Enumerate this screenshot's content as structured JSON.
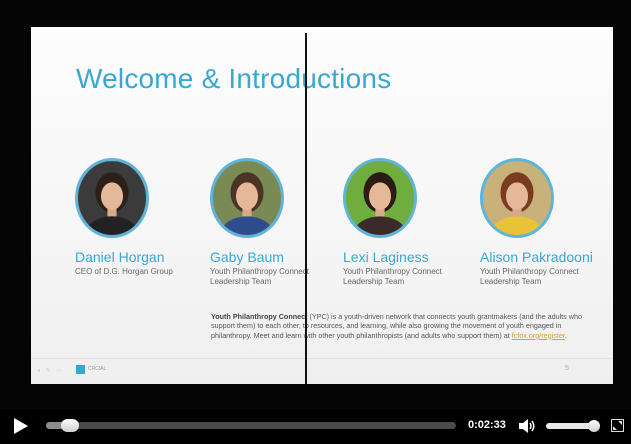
{
  "slide": {
    "title": "Welcome & Introductions",
    "page_number": "5",
    "logo_text": "CRCIAL"
  },
  "people": [
    {
      "name": "Daniel Horgan",
      "role": "CEO of D.G. Horgan Group",
      "photo_bg": "#3b3b3b",
      "hair": "#2b2118",
      "shirt": "#222222"
    },
    {
      "name": "Gaby Baum",
      "role": "Youth Philanthropy Connect Leadership Team",
      "photo_bg": "#7a8a55",
      "hair": "#4a3424",
      "shirt": "#2f4d8c"
    },
    {
      "name": "Lexi Laginess",
      "role": "Youth Philanthropy Connect Leadership Team",
      "photo_bg": "#6fae3e",
      "hair": "#2a1c14",
      "shirt": "#3b2a2a"
    },
    {
      "name": "Alison Pakradooni",
      "role": "Youth Philanthropy Connect Leadership Team",
      "photo_bg": "#c9b27a",
      "hair": "#7a3b1f",
      "shirt": "#e8c33a"
    }
  ],
  "description": {
    "org_name": "Youth Philanthropy Connect",
    "body": " (YPC) is a youth-driven network that connects youth grantmakers (and the adults who support them) to each other, to resources, and learning, while also growing the movement of youth engaged in philanthropy. Meet and learn with other youth philanthropists (and adults who support them) at ",
    "link": "fcfox.org/register",
    "end": "."
  },
  "player": {
    "time": "0:02:33",
    "progress_fraction": 0.05,
    "volume_fraction": 0.88,
    "icons": {
      "play": "play-icon",
      "volume": "volume-icon",
      "fullscreen": "fullscreen-icon"
    }
  },
  "colors": {
    "accent": "#3aa7d3",
    "link": "#e59a2b"
  }
}
